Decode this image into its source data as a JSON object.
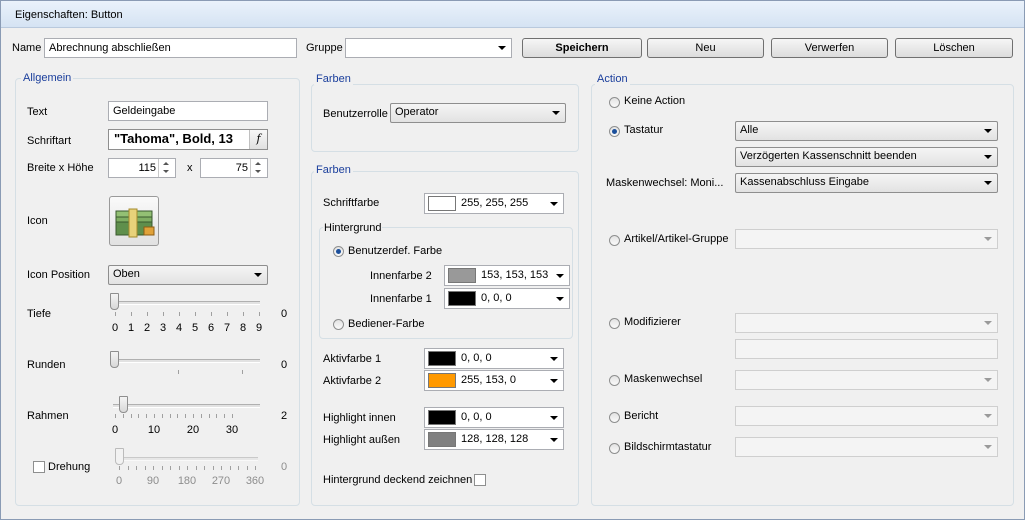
{
  "window": {
    "title": "Eigenschaften: Button"
  },
  "top": {
    "name_label": "Name",
    "name_value": "Abrechnung abschließen",
    "gruppe_label": "Gruppe",
    "gruppe_value": "",
    "buttons": [
      "Speichern",
      "Neu",
      "Verwerfen",
      "Löschen"
    ]
  },
  "allgemein": {
    "title": "Allgemein",
    "text_label": "Text",
    "text_value": "Geldeingabe",
    "font_label": "Schriftart",
    "font_value": "\"Tahoma\", Bold, 13",
    "font_btn": "f",
    "size_label": "Breite x Höhe",
    "width": "115",
    "times": "x",
    "height": "75",
    "icon_label": "Icon",
    "icon_name": "money-stack-icon",
    "iconpos_label": "Icon Position",
    "iconpos_value": "Oben",
    "tiefe_label": "Tiefe",
    "tiefe_value": "0",
    "tiefe_ticks": [
      "0",
      "1",
      "2",
      "3",
      "4",
      "5",
      "6",
      "7",
      "8",
      "9"
    ],
    "runden_label": "Runden",
    "runden_value": "0",
    "rahmen_label": "Rahmen",
    "rahmen_value": "2",
    "rahmen_ticks": [
      "0",
      "10",
      "20",
      "30"
    ],
    "drehung_label": "Drehung",
    "drehung_checked": false,
    "drehung_value": "0",
    "drehung_ticks": [
      "0",
      "90",
      "180",
      "270",
      "360"
    ]
  },
  "farben1": {
    "title": "Farben",
    "rolle_label": "Benutzerrolle",
    "rolle_value": "Operator"
  },
  "farben2": {
    "title": "Farben",
    "schrift_label": "Schriftfarbe",
    "schrift": {
      "text": "255, 255, 255",
      "color": "#ffffff"
    },
    "hintergrund_title": "Hintergrund",
    "opt_benutzer": "Benutzerdef. Farbe",
    "innen2_label": "Innenfarbe 2",
    "innen2": {
      "text": "153, 153, 153",
      "color": "#999999"
    },
    "innen1_label": "Innenfarbe 1",
    "innen1": {
      "text": "0, 0, 0",
      "color": "#000000"
    },
    "opt_bediener": "Bediener-Farbe",
    "aktiv1_label": "Aktivfarbe 1",
    "aktiv1": {
      "text": "0, 0, 0",
      "color": "#000000"
    },
    "aktiv2_label": "Aktivfarbe 2",
    "aktiv2": {
      "text": "255, 153, 0",
      "color": "#ff9900"
    },
    "hl_innen_label": "Highlight innen",
    "hl_innen": {
      "text": "0, 0, 0",
      "color": "#000000"
    },
    "hl_aussen_label": "Highlight außen",
    "hl_aussen": {
      "text": "128, 128, 128",
      "color": "#808080"
    },
    "deckend_label": "Hintergrund deckend zeichnen",
    "deckend_checked": false
  },
  "action": {
    "title": "Action",
    "keine": "Keine Action",
    "tastatur": "Tastatur",
    "tastatur_value": "Alle",
    "tastatur_value2": "Verzögerten Kassenschnitt beenden",
    "masken_moni_label": "Maskenwechsel: Moni...",
    "masken_moni_value": "Kassenabschluss Eingabe",
    "artikel": "Artikel/Artikel-Gruppe",
    "modifizierer": "Modifizierer",
    "maskenwechsel": "Maskenwechsel",
    "bericht": "Bericht",
    "bildschirm": "Bildschirmtastatur",
    "selected": "Tastatur"
  }
}
